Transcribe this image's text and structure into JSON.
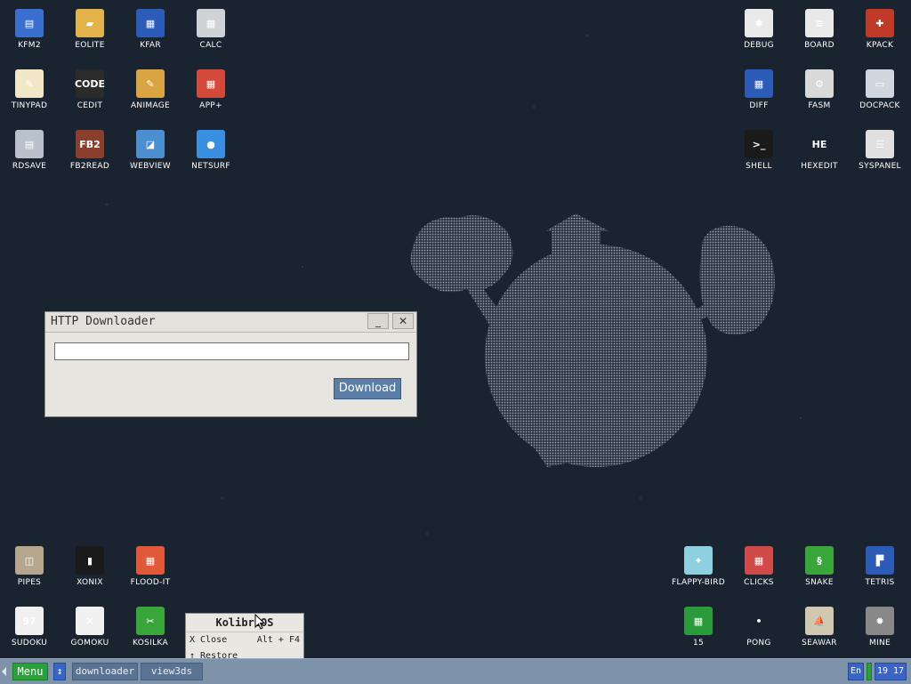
{
  "desktop": {
    "icons_top_left": [
      {
        "label": "KFM2",
        "color": "#3a6fd0",
        "glyph": "▤",
        "icon": "floppy-disk-icon"
      },
      {
        "label": "EOLITE",
        "color": "#e1b34a",
        "glyph": "▰",
        "icon": "folder-icon"
      },
      {
        "label": "KFAR",
        "color": "#2c5bb8",
        "glyph": "▦",
        "icon": "kfar-icon"
      },
      {
        "label": "CALC",
        "color": "#cfd3d8",
        "glyph": "▦",
        "icon": "calculator-icon"
      },
      {
        "label": "TINYPAD",
        "color": "#f2e8c8",
        "glyph": "✎",
        "icon": "notepad-icon"
      },
      {
        "label": "CEDIT",
        "color": "#2b2b2b",
        "glyph": "CODE",
        "icon": "code-editor-icon"
      },
      {
        "label": "ANIMAGE",
        "color": "#d9a441",
        "glyph": "✎",
        "icon": "paint-icon"
      },
      {
        "label": "APP+",
        "color": "#d44a3a",
        "glyph": "▦",
        "icon": "rubiks-cube-icon"
      },
      {
        "label": "RDSAVE",
        "color": "#b9c2cc",
        "glyph": "▤",
        "icon": "ramdisk-save-icon"
      },
      {
        "label": "FB2READ",
        "color": "#8a3e2e",
        "glyph": "FB2",
        "icon": "book-icon"
      },
      {
        "label": "WEBVIEW",
        "color": "#4c8fd0",
        "glyph": "◪",
        "icon": "browser-icon"
      },
      {
        "label": "NETSURF",
        "color": "#3a8fe0",
        "glyph": "●",
        "icon": "globe-icon"
      }
    ],
    "icons_top_right": [
      {
        "label": "DEBUG",
        "color": "#e9e9e9",
        "glyph": "✱",
        "icon": "bug-icon"
      },
      {
        "label": "BOARD",
        "color": "#e9e9e9",
        "glyph": "≡",
        "icon": "board-icon"
      },
      {
        "label": "KPACK",
        "color": "#c03a2a",
        "glyph": "✚",
        "icon": "wrench-icon"
      },
      {
        "label": "DIFF",
        "color": "#2c5bb8",
        "glyph": "▦",
        "icon": "diff-icon"
      },
      {
        "label": "FASM",
        "color": "#d9d9d9",
        "glyph": "⚙",
        "icon": "assembler-icon"
      },
      {
        "label": "DOCPACK",
        "color": "#d0d6de",
        "glyph": "▭",
        "icon": "cabinet-icon"
      },
      {
        "label": "SHELL",
        "color": "#1a1a1a",
        "glyph": ">_",
        "icon": "terminal-icon"
      },
      {
        "label": "HEXEDIT",
        "color": "#1a2330",
        "glyph": "HE",
        "icon": "hex-editor-icon"
      },
      {
        "label": "SYSPANEL",
        "color": "#e0e0e0",
        "glyph": "☰",
        "icon": "control-panel-icon"
      }
    ],
    "icons_bottom_left": [
      {
        "label": "PIPES",
        "color": "#b7a68e",
        "glyph": "◫",
        "icon": "pipes-icon"
      },
      {
        "label": "XONIX",
        "color": "#1a1a1a",
        "glyph": "▮",
        "icon": "xonix-icon"
      },
      {
        "label": "FLOOD-IT",
        "color": "#e05a3a",
        "glyph": "▦",
        "icon": "flood-it-icon"
      },
      {
        "label": "SUDOKU",
        "color": "#f0f0f0",
        "glyph": "97",
        "icon": "sudoku-icon"
      },
      {
        "label": "GOMOKU",
        "color": "#f0f0f0",
        "glyph": "✕",
        "icon": "gomoku-icon"
      },
      {
        "label": "KOSILKA",
        "color": "#3aa63a",
        "glyph": "✂",
        "icon": "lawnmower-icon"
      }
    ],
    "icons_bottom_right": [
      {
        "label": "FLAPPY-BIRD",
        "color": "#8fd0e0",
        "glyph": "✦",
        "icon": "bird-icon"
      },
      {
        "label": "CLICKS",
        "color": "#d04a4a",
        "glyph": "▦",
        "icon": "clicks-icon"
      },
      {
        "label": "SNAKE",
        "color": "#3aa63a",
        "glyph": "§",
        "icon": "snake-icon"
      },
      {
        "label": "TETRIS",
        "color": "#2c5bb8",
        "glyph": "▛",
        "icon": "tetris-icon"
      },
      {
        "label": "15",
        "color": "#2a9a3a",
        "glyph": "▦",
        "icon": "fifteen-puzzle-icon"
      },
      {
        "label": "PONG",
        "color": "#1a2330",
        "glyph": "•",
        "icon": "pong-icon"
      },
      {
        "label": "SEAWAR",
        "color": "#d0c8b0",
        "glyph": "⛵",
        "icon": "ship-icon"
      },
      {
        "label": "MINE",
        "color": "#888888",
        "glyph": "✹",
        "icon": "mine-icon"
      }
    ]
  },
  "window": {
    "title": "HTTP Downloader",
    "minimize_glyph": "_",
    "close_glyph": "✕",
    "url_value": "",
    "download_label": "Download"
  },
  "context_menu": {
    "title": "KolibriOS",
    "items": [
      {
        "label": "X Close",
        "shortcut": "Alt + F4"
      },
      {
        "label": "↑ Restore",
        "shortcut": ""
      }
    ]
  },
  "taskbar": {
    "menu_label": "Menu",
    "arrows_glyph": "↕",
    "tasks": [
      {
        "label": "downloader"
      },
      {
        "label": "view3ds"
      }
    ],
    "lang": "En",
    "clock": "19 17"
  },
  "colors": {
    "desktop_bg": "#1a2330",
    "taskbar": "#7e92a9",
    "accent_blue": "#3a64c6",
    "accent_green": "#2aa23c"
  }
}
